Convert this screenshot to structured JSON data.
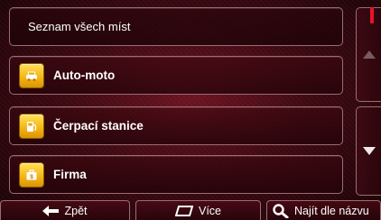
{
  "list": {
    "header_label": "Seznam všech míst",
    "items": [
      {
        "label": "Auto-moto",
        "icon": "car-icon"
      },
      {
        "label": "Čerpací stanice",
        "icon": "fuel-pump-icon"
      },
      {
        "label": "Firma",
        "icon": "briefcase-icon"
      }
    ]
  },
  "bottom_bar": {
    "back_label": "Zpět",
    "more_label": "Více",
    "find_label": "Najít dle názvu"
  },
  "colors": {
    "background": "#4a0c16",
    "icon_yellow": "#f3b313",
    "scroll_thumb": "#e7132a",
    "border": "#9b6d74"
  }
}
